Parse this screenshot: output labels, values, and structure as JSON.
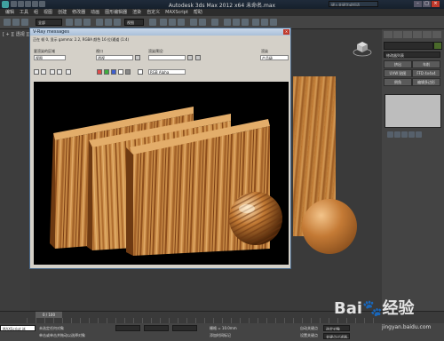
{
  "app": {
    "title": "Autodesk 3ds Max  2012 x64    未命名.max",
    "search_placeholder": "键入关键字或短语",
    "window_buttons": [
      "–",
      "□",
      "×"
    ]
  },
  "menu": [
    "编辑",
    "工具",
    "组",
    "视图",
    "创建",
    "修改器",
    "动画",
    "图形编辑器",
    "渲染",
    "自定义",
    "MAXScript",
    "帮助"
  ],
  "toolbar": {
    "selection_filter": "全部",
    "view_dropdown": "视图"
  },
  "viewport": {
    "label": "[ + ][ 透视 ][ 真实 ]"
  },
  "command_panel": {
    "dropdown": "修改器列表",
    "buttons": [
      "挤出",
      "车削",
      "UVW 贴图",
      "FFD 4x4x4",
      "倒角",
      "编辑多边形"
    ],
    "stack_label": "修改器列表"
  },
  "vfb": {
    "title": "V-Ray messages",
    "subtitle": "正在 帧 0, 显示 gamma: 2.2, RGBA 颜色 16 位/通道 (1:4)",
    "channel_label": "要渲染的区域",
    "channel_value": "视图",
    "viewport_label": "视口",
    "viewport_value": "透视",
    "preset_label": "渲染预设:",
    "preset_value": "",
    "renderer_label": "渲染",
    "renderer_value": "产品级",
    "channel_select": "RGB Alpha"
  },
  "timeline": {
    "slider": "0 / 100"
  },
  "status": {
    "selected": "未选定任何对象",
    "prompt": "单击或单击并拖动以选择对象",
    "maxscript": "MAXScript 迷",
    "grid": "栅格 = 10.0mm",
    "auto_key": "自动关键点",
    "set_key": "设置关键点",
    "key_mode": "选定对象",
    "key_filter": "关键点过滤器...",
    "add_time_tag": "添加时间标记"
  },
  "watermark": {
    "text": "Bai🐾经验",
    "sub": "jingyan.baidu.com"
  },
  "colors": {
    "wood_light": "#d49a55",
    "wood_dark": "#8a4c1a",
    "titlebar": "#1f2b3a"
  }
}
